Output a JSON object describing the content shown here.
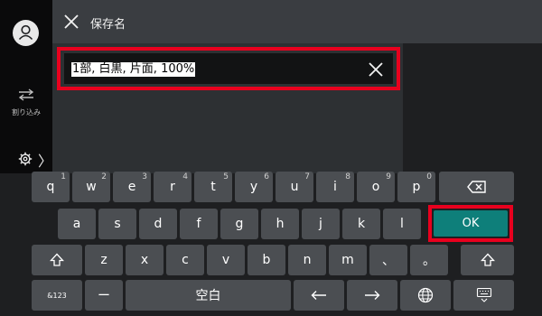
{
  "header": {
    "title": "保存名"
  },
  "sidebar": {
    "interrupt_label": "割り込み"
  },
  "field": {
    "value": "1部, 白黒, 片面, 100%"
  },
  "keyboard": {
    "row1": [
      {
        "k": "q",
        "n": "1"
      },
      {
        "k": "w",
        "n": "2"
      },
      {
        "k": "e",
        "n": "3"
      },
      {
        "k": "r",
        "n": "4"
      },
      {
        "k": "t",
        "n": "5"
      },
      {
        "k": "y",
        "n": "6"
      },
      {
        "k": "u",
        "n": "7"
      },
      {
        "k": "i",
        "n": "8"
      },
      {
        "k": "o",
        "n": "9"
      },
      {
        "k": "p",
        "n": "0"
      }
    ],
    "row2": [
      "a",
      "s",
      "d",
      "f",
      "g",
      "h",
      "j",
      "k",
      "l"
    ],
    "ok_label": "OK",
    "row3": [
      "z",
      "x",
      "c",
      "v",
      "b",
      "n",
      "m",
      "、",
      "。"
    ],
    "mode_label": "&123",
    "dash_label": "ー",
    "space_label": "空白"
  },
  "icons": [
    "user-icon",
    "interrupt-icon",
    "settings-gear-icon",
    "close-icon",
    "clear-icon",
    "backspace-icon",
    "shift-icon",
    "globe-icon",
    "keyboard-hide-icon",
    "arrow-left-icon",
    "arrow-right-icon"
  ]
}
